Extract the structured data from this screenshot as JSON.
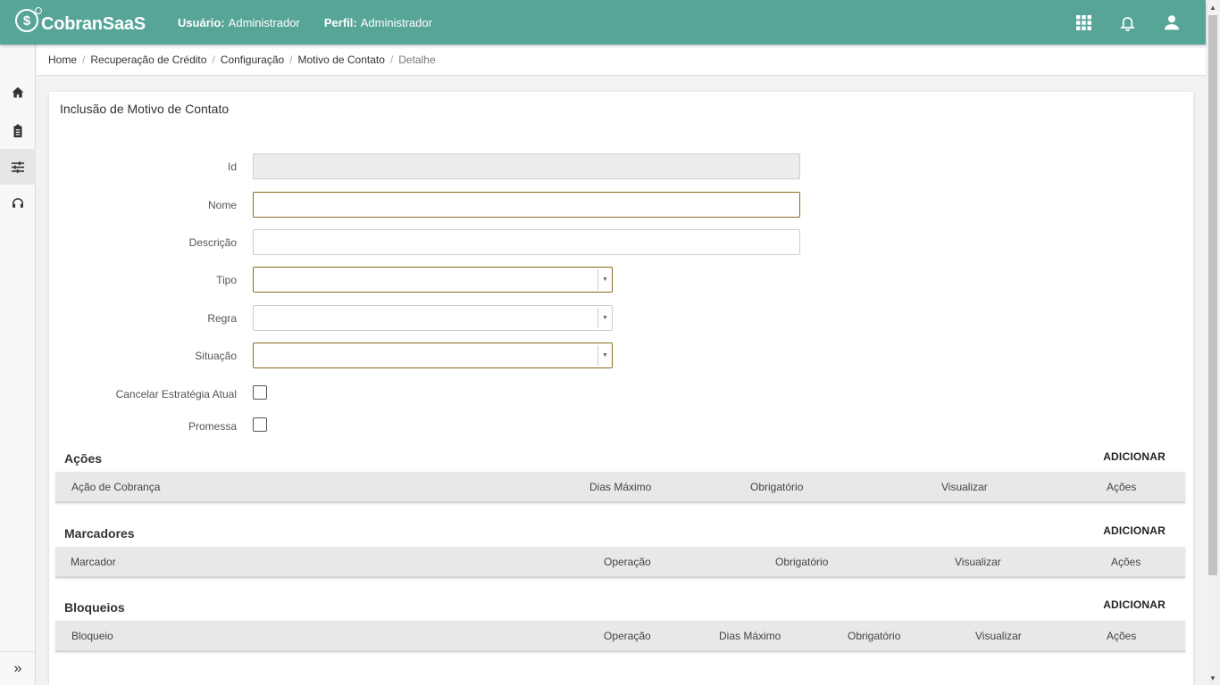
{
  "app": {
    "brand": "CobranSaaS",
    "logo_glyph": "$",
    "accent_color": "#57a596"
  },
  "user": {
    "user_label": "Usuário:",
    "user_value": "Administrador",
    "profile_label": "Perfil:",
    "profile_value": "Administrador"
  },
  "top_icons": [
    "apps-grid-icon",
    "bell-icon",
    "user-icon"
  ],
  "sidebar": {
    "items": [
      "home-icon",
      "clipboard-icon",
      "tune-icon",
      "headset-icon"
    ],
    "active_index": 2,
    "expand_glyph": "»"
  },
  "breadcrumb": {
    "items": [
      "Home",
      "Recuperação de Crédito",
      "Configuração",
      "Motivo de Contato"
    ],
    "current": "Detalhe",
    "separator": "/"
  },
  "form": {
    "title": "Inclusão de Motivo de Contato",
    "fields": {
      "id": {
        "label": "Id",
        "value": ""
      },
      "nome": {
        "label": "Nome",
        "value": ""
      },
      "descricao": {
        "label": "Descrição",
        "value": ""
      },
      "tipo": {
        "label": "Tipo",
        "value": ""
      },
      "regra": {
        "label": "Regra",
        "value": ""
      },
      "situacao": {
        "label": "Situação",
        "value": ""
      },
      "cancelar": {
        "label": "Cancelar Estratégia Atual",
        "checked": false
      },
      "promessa": {
        "label": "Promessa",
        "checked": false
      }
    }
  },
  "sections": {
    "acoes": {
      "title": "Ações",
      "add_label": "ADICIONAR",
      "columns": [
        "Ação de Cobrança",
        "Dias Máximo",
        "Obrigatório",
        "Visualizar",
        "Ações"
      ]
    },
    "marcadores": {
      "title": "Marcadores",
      "add_label": "ADICIONAR",
      "columns": [
        "Marcador",
        "Operação",
        "Obrigatório",
        "Visualizar",
        "Ações"
      ]
    },
    "bloqueios": {
      "title": "Bloqueios",
      "add_label": "ADICIONAR",
      "columns": [
        "Bloqueio",
        "Operação",
        "Dias Máximo",
        "Obrigatório",
        "Visualizar",
        "Ações"
      ]
    }
  }
}
